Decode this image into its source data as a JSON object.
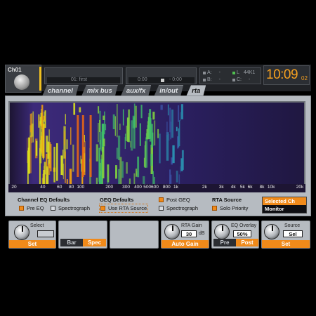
{
  "header": {
    "channel": "Ch01",
    "scene": "01: first",
    "time_left": "0:00",
    "time_right": "- 0:00",
    "usb": {
      "a": "A:",
      "a_val": "-",
      "b": "B:",
      "b_val": "-",
      "l": "L",
      "l_val": "44K1",
      "c": "C:",
      "c_val": "-"
    },
    "clock_main": "10:09",
    "clock_sec": "02"
  },
  "tabs": [
    {
      "label": "channel"
    },
    {
      "label": "mix bus"
    },
    {
      "label": "aux/fx"
    },
    {
      "label": "in/out"
    },
    {
      "label": "rta"
    }
  ],
  "axis_ticks": [
    "20",
    "40",
    "60",
    "80",
    "100",
    "200",
    "300",
    "400",
    "500",
    "600",
    "800",
    "1k",
    "2k",
    "3k",
    "4k",
    "5k",
    "6k",
    "8k",
    "10k",
    "20k"
  ],
  "options": {
    "ch_eq_title": "Channel EQ Defaults",
    "pre_eq": "Pre EQ",
    "spectrograph1": "Spectrograph",
    "geq_title": "GEQ Defaults",
    "use_rta": "Use RTA Source",
    "post_geq": "Post GEQ",
    "spectrograph2": "Spectrograph",
    "rta_source_title": "RTA Source",
    "solo_priority": "Solo Priority",
    "selected_ch": "Selected Ch",
    "monitor": "Monitor"
  },
  "bottom": {
    "select_label": "Select",
    "set1": "Set",
    "bar": "Bar",
    "spec": "Spec",
    "rta_gain_label": "RTA Gain",
    "rta_gain_value": "30",
    "rta_gain_unit": "dB",
    "auto_gain": "Auto Gain",
    "eq_overlay_label": "EQ Overlay",
    "eq_overlay_value": "50%",
    "pre": "Pre",
    "post": "Post",
    "source_label": "Source",
    "source_value": "Sel",
    "set2": "Set"
  },
  "colors": {
    "accent": "#f08a1a",
    "clock": "#f5a020",
    "panel": "#b6bbc1"
  }
}
